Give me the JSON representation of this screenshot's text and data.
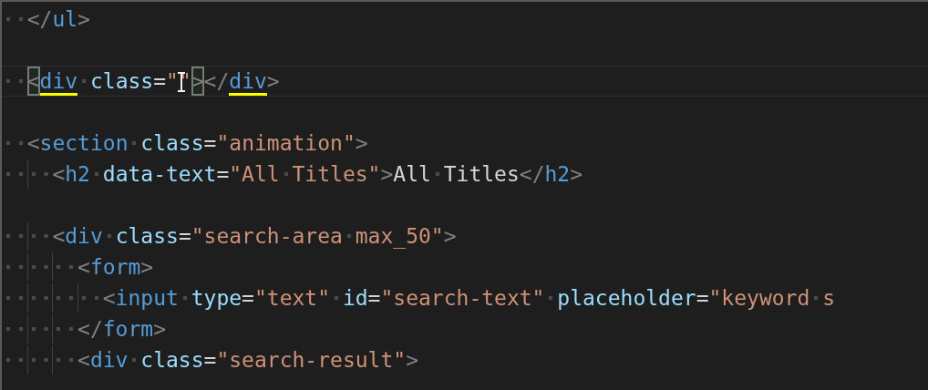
{
  "editor": {
    "lines": [
      {
        "current": false,
        "tokens": [
          {
            "kind": "punct",
            "text": "  </"
          },
          {
            "kind": "tag",
            "text": "ul"
          },
          {
            "kind": "punct",
            "text": ">"
          }
        ]
      },
      {
        "current": false
      },
      {
        "current": true,
        "tokens": [
          {
            "kind": "punct",
            "text": "  <",
            "matched": true
          },
          {
            "kind": "tag",
            "text": "div",
            "highlighted": true
          },
          {
            "kind": "attr",
            "text": " class"
          },
          {
            "kind": "op",
            "text": "="
          },
          {
            "kind": "string",
            "text": "\"\"",
            "mouse_pointer": true
          },
          {
            "kind": "punct",
            "text": ">",
            "matched": true
          },
          {
            "kind": "punct",
            "text": "</"
          },
          {
            "kind": "tag",
            "text": "div",
            "highlighted": true
          },
          {
            "kind": "punct",
            "text": ">"
          }
        ]
      },
      {
        "current": false
      },
      {
        "current": false,
        "tokens": [
          {
            "kind": "punct",
            "text": "  <"
          },
          {
            "kind": "tag",
            "text": "section"
          },
          {
            "kind": "attr",
            "text": " class"
          },
          {
            "kind": "op",
            "text": "="
          },
          {
            "kind": "string",
            "text": "\"animation\""
          },
          {
            "kind": "punct",
            "text": ">"
          }
        ]
      },
      {
        "current": false,
        "tokens": [
          {
            "kind": "punct",
            "text": "    <"
          },
          {
            "kind": "tag",
            "text": "h2"
          },
          {
            "kind": "attr",
            "text": " data-text"
          },
          {
            "kind": "op",
            "text": "="
          },
          {
            "kind": "string",
            "text": "\"All Titles\""
          },
          {
            "kind": "punct",
            "text": ">"
          },
          {
            "kind": "text",
            "text": "All Titles"
          },
          {
            "kind": "punct",
            "text": "</"
          },
          {
            "kind": "tag",
            "text": "h2"
          },
          {
            "kind": "punct",
            "text": ">"
          }
        ]
      },
      {
        "current": false
      },
      {
        "current": false,
        "tokens": [
          {
            "kind": "punct",
            "text": "    <"
          },
          {
            "kind": "tag",
            "text": "div"
          },
          {
            "kind": "attr",
            "text": " class"
          },
          {
            "kind": "op",
            "text": "="
          },
          {
            "kind": "string",
            "text": "\"search-area max_50\""
          },
          {
            "kind": "punct",
            "text": ">"
          }
        ]
      },
      {
        "current": false,
        "tokens": [
          {
            "kind": "punct",
            "text": "      <"
          },
          {
            "kind": "tag",
            "text": "form"
          },
          {
            "kind": "punct",
            "text": ">"
          }
        ]
      },
      {
        "current": false,
        "tokens": [
          {
            "kind": "punct",
            "text": "        <"
          },
          {
            "kind": "tag",
            "text": "input"
          },
          {
            "kind": "attr",
            "text": " type"
          },
          {
            "kind": "op",
            "text": "="
          },
          {
            "kind": "string",
            "text": "\"text\""
          },
          {
            "kind": "attr",
            "text": " id"
          },
          {
            "kind": "op",
            "text": "="
          },
          {
            "kind": "string",
            "text": "\"search-text\""
          },
          {
            "kind": "attr",
            "text": " placeholder"
          },
          {
            "kind": "op",
            "text": "="
          },
          {
            "kind": "string",
            "text": "\"keyword s"
          }
        ]
      },
      {
        "current": false,
        "tokens": [
          {
            "kind": "punct",
            "text": "      </"
          },
          {
            "kind": "tag",
            "text": "form"
          },
          {
            "kind": "punct",
            "text": ">"
          }
        ]
      },
      {
        "current": false,
        "tokens": [
          {
            "kind": "punct",
            "text": "      <"
          },
          {
            "kind": "tag",
            "text": "div"
          },
          {
            "kind": "attr",
            "text": " class"
          },
          {
            "kind": "op",
            "text": "="
          },
          {
            "kind": "string",
            "text": "\"search-result\""
          },
          {
            "kind": "punct",
            "text": ">"
          }
        ]
      }
    ]
  }
}
